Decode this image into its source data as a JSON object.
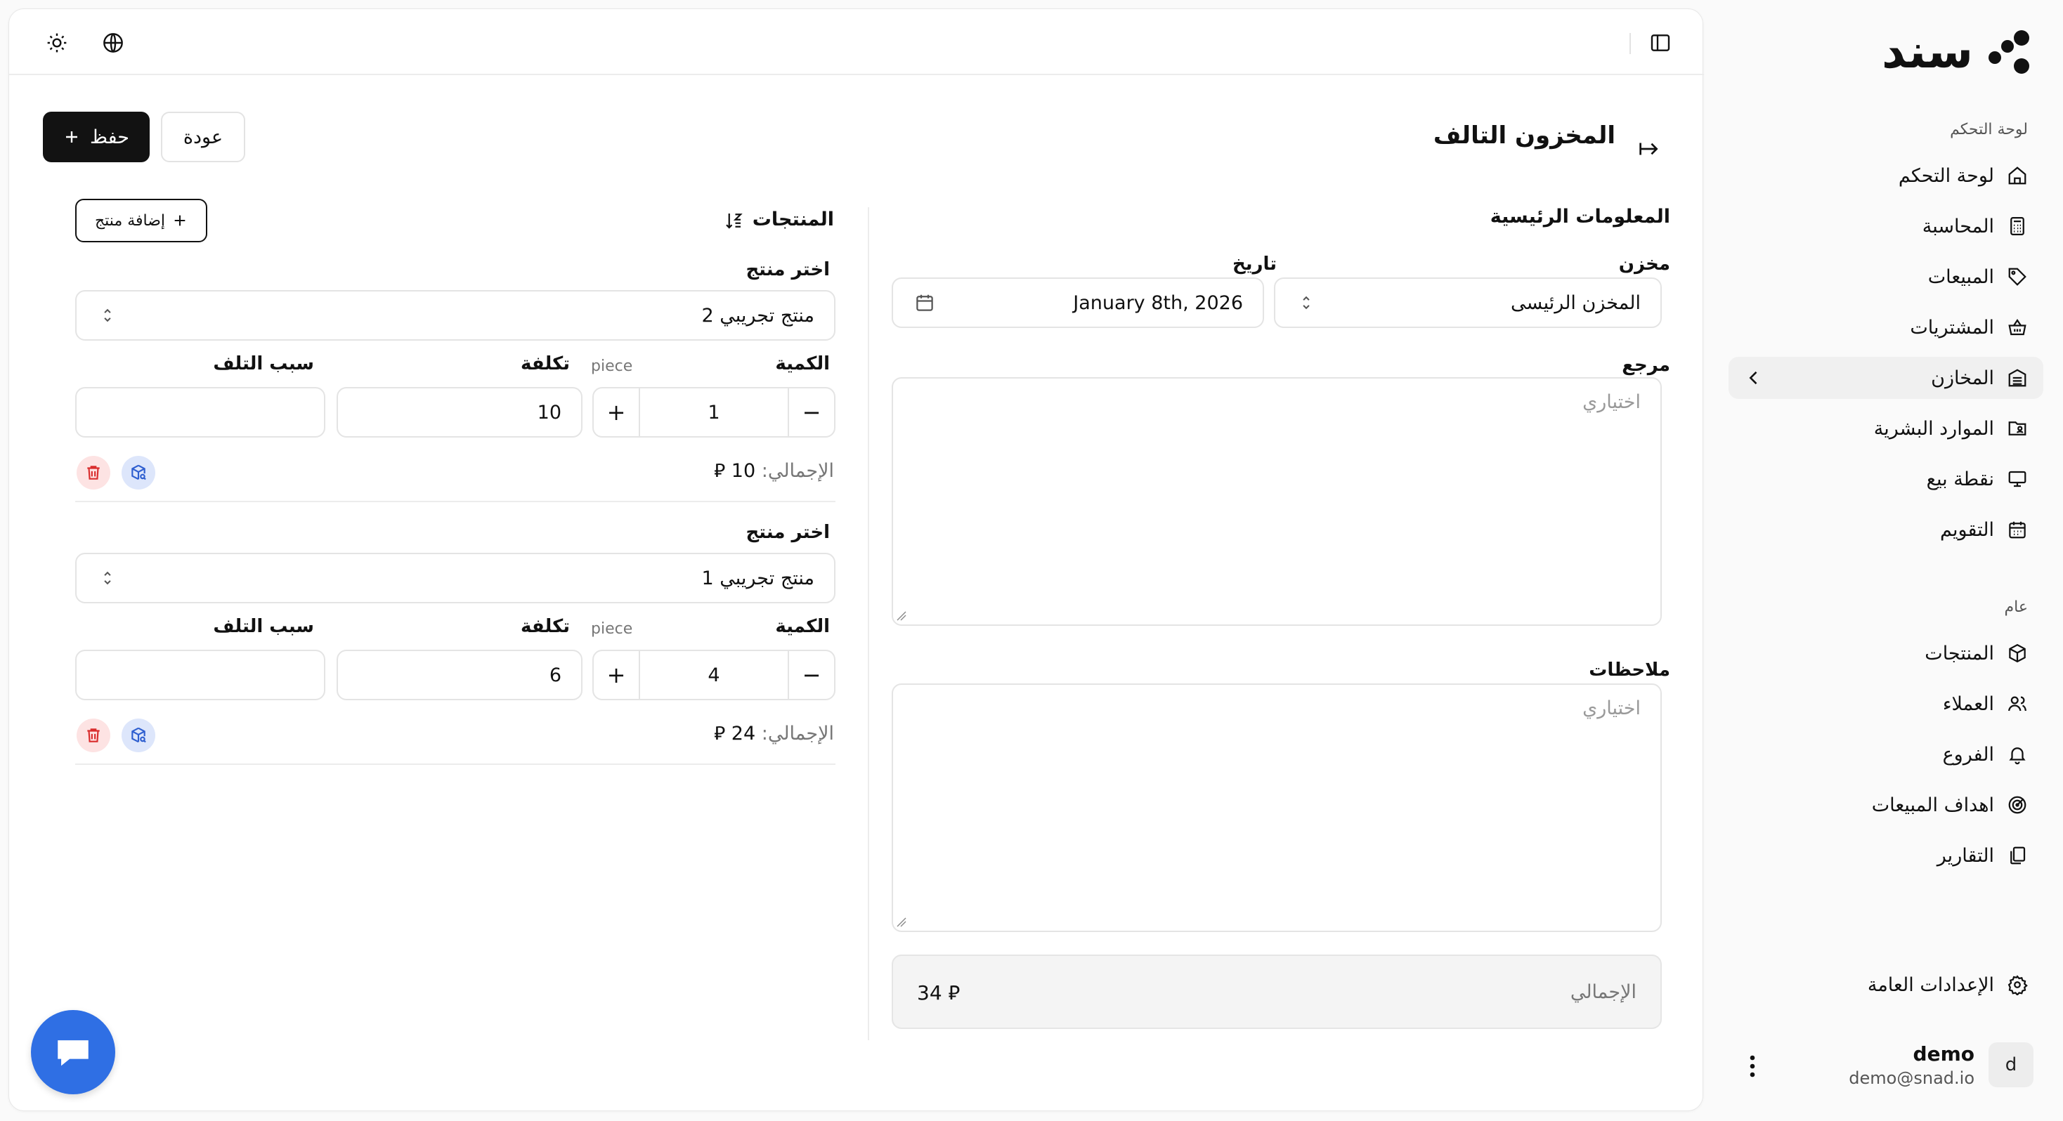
{
  "brand": {
    "name": "سند",
    "logo": "snad-dots-logo"
  },
  "sidebar": {
    "group_main": "لوحة التحكم",
    "group_general": "عام",
    "items": [
      {
        "label": "لوحة التحكم",
        "icon": "home-icon"
      },
      {
        "label": "المحاسبة",
        "icon": "calculator-icon"
      },
      {
        "label": "المبيعات",
        "icon": "tag-icon"
      },
      {
        "label": "المشتريات",
        "icon": "basket-icon"
      },
      {
        "label": "المخازن",
        "icon": "warehouse-icon"
      },
      {
        "label": "الموارد البشرية",
        "icon": "hr-icon"
      },
      {
        "label": "نقطة بيع",
        "icon": "monitor-icon"
      },
      {
        "label": "التقويم",
        "icon": "calendar-icon"
      },
      {
        "label": "المنتجات",
        "icon": "box-icon"
      },
      {
        "label": "العملاء",
        "icon": "users-icon"
      },
      {
        "label": "الفروع",
        "icon": "bell-icon"
      },
      {
        "label": "اهداف المبيعات",
        "icon": "target-icon"
      },
      {
        "label": "التقارير",
        "icon": "copy-icon"
      },
      {
        "label": "الإعدادات العامة",
        "icon": "gear-icon"
      }
    ],
    "user": {
      "initial": "d",
      "name": "demo",
      "email": "demo@snad.io"
    }
  },
  "page": {
    "title": "المخزون التالف",
    "save_label": "حفظ",
    "back_label": "عودة"
  },
  "main_info": {
    "section_title": "المعلومات الرئيسية",
    "warehouse_label": "مخزن",
    "warehouse_value": "المخزن الرئيسى",
    "date_label": "تاريخ",
    "date_value": "January 8th, 2026",
    "reference_label": "مرجع",
    "reference_placeholder": "اختياري",
    "notes_label": "ملاحظات",
    "notes_placeholder": "اختياري",
    "total_label": "الإجمالي",
    "total_value": "34 ⃁"
  },
  "products": {
    "section_title": "المنتجات",
    "add_label": "إضافة منتج",
    "select_label": "اختر منتج",
    "qty_label": "الكمية",
    "unit": "piece",
    "cost_label": "تكلفة",
    "reason_label": "سبب التلف",
    "total_prefix": "الإجمالي:",
    "lines": [
      {
        "product": "منتج تجريبي 2",
        "qty": "1",
        "cost": "10",
        "reason": "",
        "total": "10 ⃁"
      },
      {
        "product": "منتج تجريبي 1",
        "qty": "4",
        "cost": "6",
        "reason": "",
        "total": "24 ⃁"
      }
    ]
  },
  "colors": {
    "primary": "#121212",
    "accent_blue": "#2f6fe4",
    "danger_bg": "#fde3e3",
    "stock_bg": "#dde6fb"
  }
}
